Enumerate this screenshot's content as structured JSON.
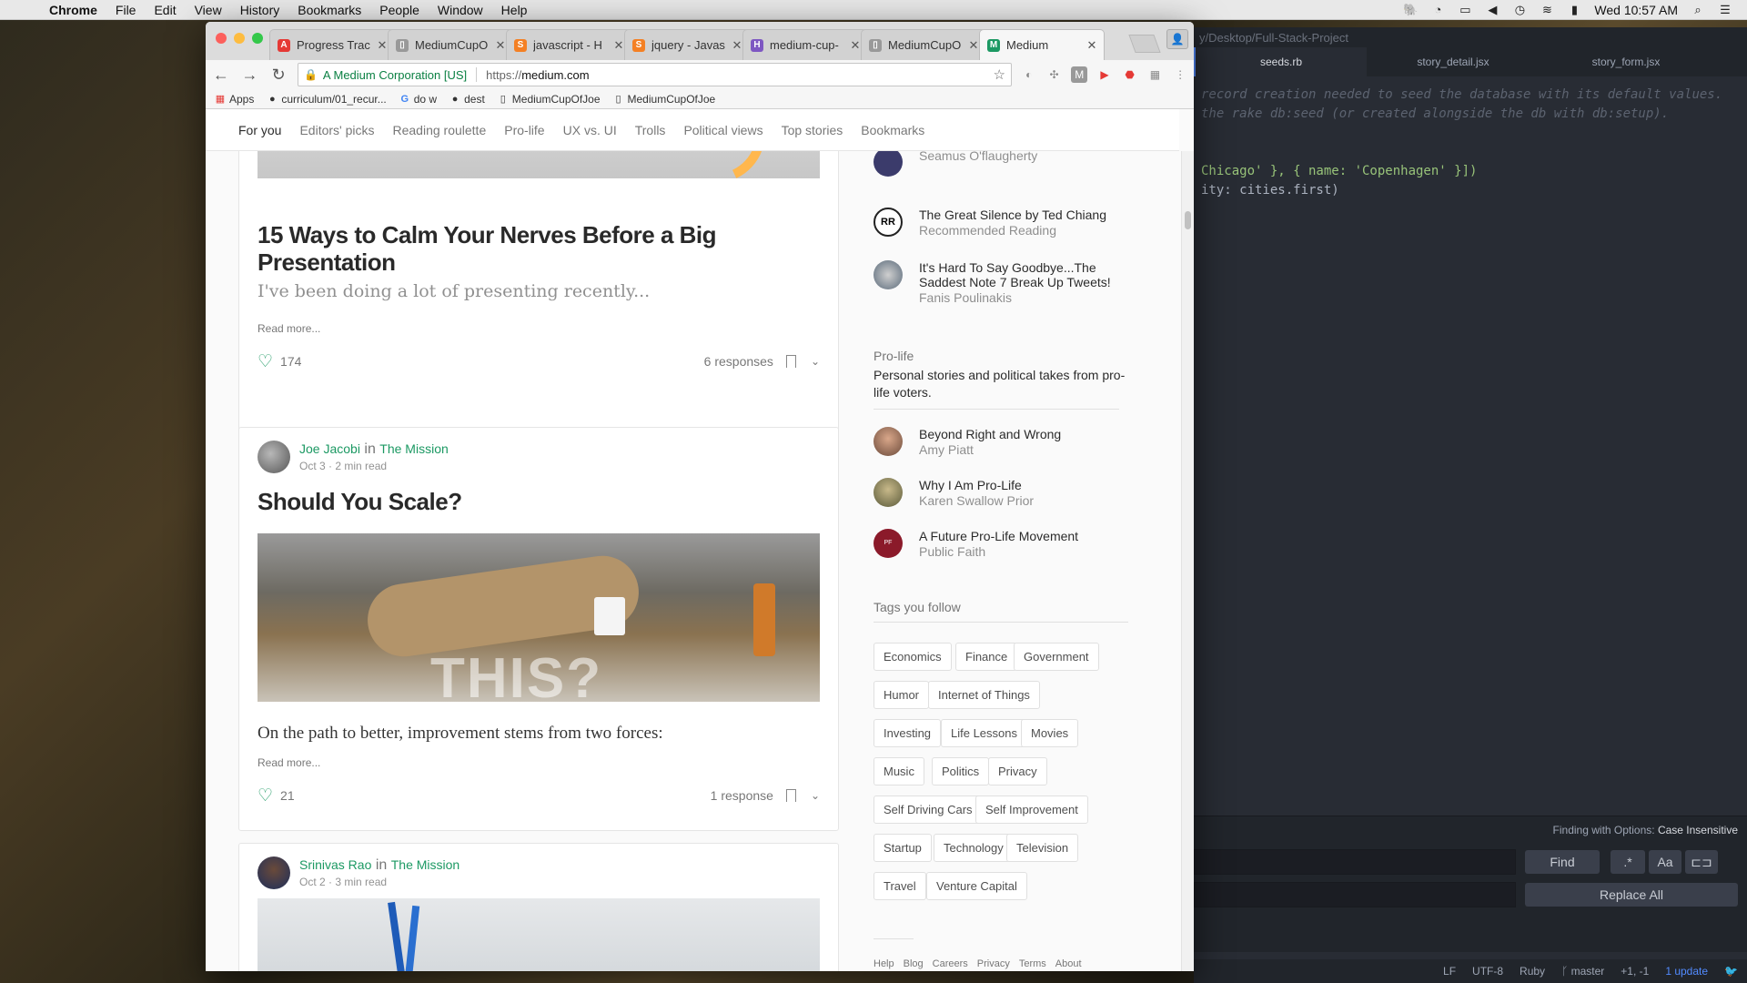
{
  "menubar": {
    "app": "Chrome",
    "items": [
      "File",
      "Edit",
      "View",
      "History",
      "Bookmarks",
      "People",
      "Window",
      "Help"
    ],
    "clock": "Wed 10:57 AM"
  },
  "editor": {
    "path": "y/Desktop/Full-Stack-Project",
    "tabs": [
      "seeds.rb",
      "story_detail.jsx",
      "story_form.jsx"
    ],
    "code_lines": [
      "record creation needed to seed the database with its default values.",
      "the rake db:seed (or created alongside the db with db:setup)."
    ],
    "code_line3_str": "Chicago' }, { name: 'Copenhagen' }])",
    "code_line4": "ity: cities.first)",
    "find_options_label": "Finding with Options:",
    "find_options_value": "Case Insensitive",
    "find_button": "Find",
    "regex_button": ".*",
    "case_button": "Aa",
    "replace_all_button": "Replace All",
    "status": [
      "LF",
      "UTF-8",
      "Ruby",
      "master",
      "+1, -1",
      "1 update"
    ]
  },
  "browser": {
    "tabs": [
      {
        "title": "Progress Trac",
        "icon": "A",
        "color": "#e53935"
      },
      {
        "title": "MediumCupO",
        "icon": "▯",
        "color": "#999"
      },
      {
        "title": "javascript - H",
        "icon": "S",
        "color": "#f48024"
      },
      {
        "title": "jquery - Javas",
        "icon": "S",
        "color": "#f48024"
      },
      {
        "title": "medium-cup-",
        "icon": "H",
        "color": "#7e57c2"
      },
      {
        "title": "MediumCupO",
        "icon": "▯",
        "color": "#999"
      },
      {
        "title": "Medium",
        "icon": "M",
        "color": "#1c9963"
      }
    ],
    "org": "A Medium Corporation [US]",
    "url_scheme": "https://",
    "url_host": "medium.com",
    "bookmarks": [
      "Apps",
      "curriculum/01_recur...",
      "do w",
      "dest",
      "MediumCupOfJoe",
      "MediumCupOfJoe"
    ]
  },
  "medium": {
    "nav": [
      "For you",
      "Editors' picks",
      "Reading roulette",
      "Pro-life",
      "UX vs. UI",
      "Trolls",
      "Political views",
      "Top stories",
      "Bookmarks"
    ],
    "post1": {
      "title": "15 Ways to Calm Your Nerves Before a Big Presentation",
      "subtitle": "I've been doing a lot of presenting recently...",
      "read_more": "Read more...",
      "claps": "174",
      "responses": "6 responses"
    },
    "post2": {
      "author": "Joe Jacobi",
      "in": "in",
      "publication": "The Mission",
      "meta": "Oct 3 · 2 min read",
      "title": "Should You Scale?",
      "image_text": "THIS?",
      "excerpt": "On the path to better, improvement stems from two forces:",
      "read_more": "Read more...",
      "claps": "21",
      "responses": "1 response"
    },
    "post3": {
      "author": "Srinivas Rao",
      "in": "in",
      "publication": "The Mission",
      "meta": "Oct 2 · 3 min read"
    },
    "sidebar": {
      "top_items": [
        {
          "title": "",
          "author": "Seamus O'flaugherty"
        },
        {
          "title": "The Great Silence by Ted Chiang",
          "author": "Recommended Reading"
        },
        {
          "title": "It's Hard To Say Goodbye...The Saddest Note 7 Break Up Tweets!",
          "author": "Fanis Poulinakis"
        }
      ],
      "section_label": "Pro-life",
      "section_desc": "Personal stories and political takes from pro-life voters.",
      "section_items": [
        {
          "title": "Beyond Right and Wrong",
          "author": "Amy Piatt"
        },
        {
          "title": "Why I Am Pro-Life",
          "author": "Karen Swallow Prior"
        },
        {
          "title": "A Future Pro-Life Movement",
          "author": "Public Faith"
        }
      ],
      "tags_label": "Tags you follow",
      "tags": [
        "Economics",
        "Finance",
        "Government",
        "Humor",
        "Internet of Things",
        "Investing",
        "Life Lessons",
        "Movies",
        "Music",
        "Politics",
        "Privacy",
        "Self Driving Cars",
        "Self Improvement",
        "Startup",
        "Technology",
        "Television",
        "Travel",
        "Venture Capital"
      ],
      "footer": [
        "Help",
        "Blog",
        "Careers",
        "Privacy",
        "Terms",
        "About"
      ]
    }
  }
}
